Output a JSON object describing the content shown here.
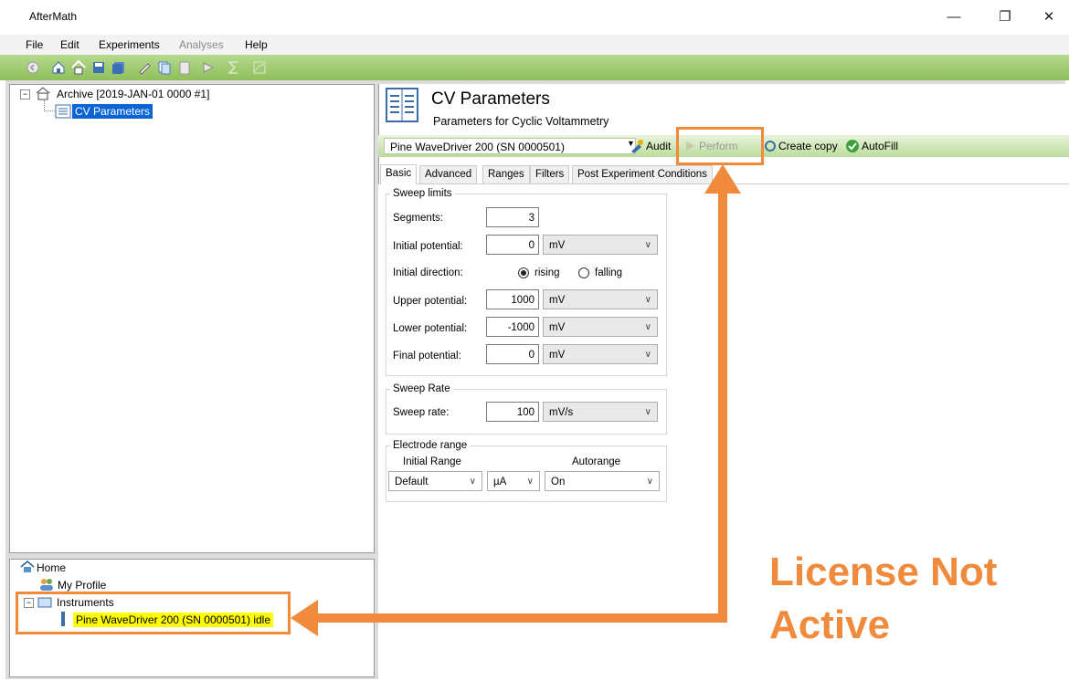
{
  "window": {
    "title": "AfterMath",
    "controls": {
      "minimize": "—",
      "maximize": "❐",
      "close": "✕"
    }
  },
  "menu": [
    {
      "label": "File",
      "enabled": true
    },
    {
      "label": "Edit",
      "enabled": true
    },
    {
      "label": "Experiments",
      "enabled": true
    },
    {
      "label": "Analyses",
      "enabled": false
    },
    {
      "label": "Help",
      "enabled": true
    }
  ],
  "tree": {
    "root_label": "Archive [2019-JAN-01 0000 #1]",
    "child_label": "CV Parameters"
  },
  "home_tree": {
    "home_label": "Home",
    "profile_label": "My Profile",
    "instruments_label": "Instruments",
    "instrument_item": "Pine WaveDriver 200 (SN 0000501) idle"
  },
  "header": {
    "title": "CV Parameters",
    "subtitle": "Parameters for Cyclic Voltammetry"
  },
  "instrument_bar": {
    "selected_instrument": "Pine WaveDriver 200 (SN 0000501)",
    "audit_label": "Audit",
    "perform_label": "Perform",
    "create_copy_label": "Create copy",
    "autofill_label": "AutoFill"
  },
  "tabs": [
    "Basic",
    "Advanced",
    "Ranges",
    "Filters",
    "Post Experiment Conditions"
  ],
  "active_tab": "Basic",
  "sweep_limits": {
    "title": "Sweep limits",
    "segments_label": "Segments:",
    "segments_value": "3",
    "initial_potential_label": "Initial potential:",
    "initial_potential_value": "0",
    "initial_potential_unit": "mV",
    "initial_direction_label": "Initial direction:",
    "rising_label": "rising",
    "falling_label": "falling",
    "direction_selected": "rising",
    "upper_potential_label": "Upper potential:",
    "upper_potential_value": "1000",
    "upper_potential_unit": "mV",
    "lower_potential_label": "Lower potential:",
    "lower_potential_value": "-1000",
    "lower_potential_unit": "mV",
    "final_potential_label": "Final potential:",
    "final_potential_value": "0",
    "final_potential_unit": "mV"
  },
  "sweep_rate": {
    "title": "Sweep Rate",
    "rate_label": "Sweep rate:",
    "rate_value": "100",
    "rate_unit": "mV/s"
  },
  "electrode_range": {
    "title": "Electrode range",
    "initial_range_label": "Initial Range",
    "autorange_label": "Autorange",
    "initial_range_value": "Default",
    "unit_value": "µA",
    "autorange_value": "On"
  },
  "annotation": {
    "line1": "License Not",
    "line2": "Active",
    "color": "#f08a3c"
  }
}
